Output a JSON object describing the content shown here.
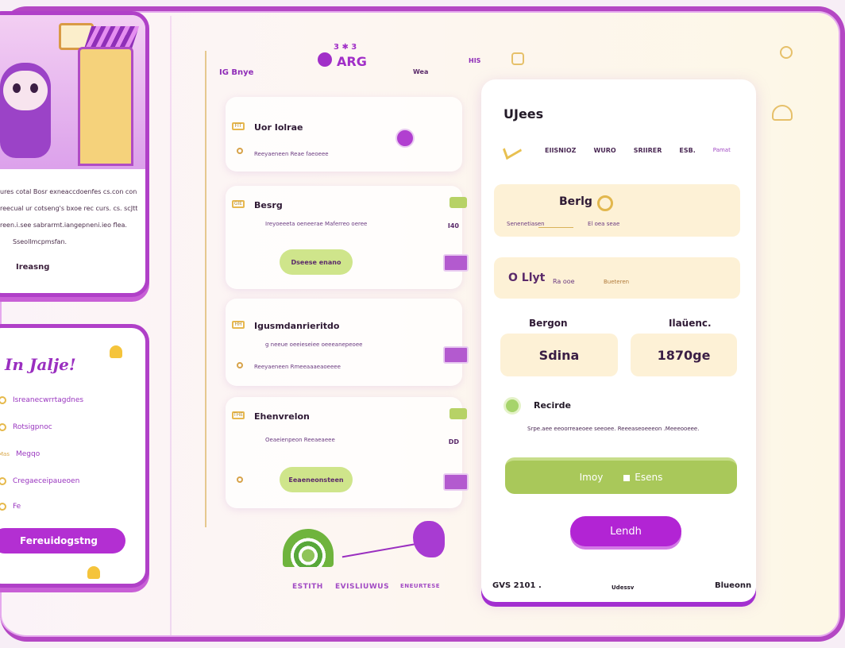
{
  "left": {
    "top_card": {
      "description_lines": [
        "ures cotal Bosr exneaccdoenfes cs.con con",
        "reecual ur cotseng's bxoe rec curs. cs. scJtt",
        "reen.i.see sabrarmt.iangepneni.ieo flea.",
        "Sseollmcpmsfan."
      ],
      "footer_link": "Ireasng"
    },
    "bottom_card": {
      "title": "In Jalje!",
      "menu_items": [
        "Isreanecwrrtagdnes",
        "Rotsigpnoc",
        "Megqo",
        "Cregaeceipaueoen",
        "Fe"
      ],
      "menu_badge": "Mas",
      "cta_label": "Fereuidogstng"
    }
  },
  "middle": {
    "header_left": "IG Bnye",
    "logo_text": "ARG",
    "logo_top": "3 ✱ 3",
    "header_right": "Wea",
    "header_right2": "HIS",
    "panels": [
      {
        "tag": "FIT",
        "title": "Uor Iolrae",
        "sub": "Reeyaeneen Reae faeoeee"
      },
      {
        "tag": "GIE",
        "title": "Besrg",
        "sub": "Ireyoeeeta oeneerae Maferreo oeree",
        "button": "Dseese enano",
        "num": "I40"
      },
      {
        "tag": "HH",
        "title": "Igusmdanrieritdo",
        "sub": "g neeue oeeieseiee oeeeanepeoee",
        "sub2": "Reeyaeneen Rmeeaaaeaoeeee"
      },
      {
        "tag": "THE",
        "title": "Ehenvrelon",
        "sub": "Oeaeienpeon Reeaeaeee",
        "button": "Eeaeneonsteen",
        "num": "DD"
      }
    ],
    "footer_links": [
      "ESTITH",
      "EVISLIUWUS",
      "ENEURTESE"
    ]
  },
  "right": {
    "title": "UJees",
    "tabs": [
      "EIISNIOZ",
      "WURO",
      "SRIIRER",
      "ESB."
    ],
    "tab_accent": "Pamat",
    "box1": {
      "heading": "Berlg",
      "sub_left": "Senenetiasen",
      "sub_right": "El oea seae"
    },
    "box2": {
      "heading": "O Llyt",
      "suffix": "Ra ooe",
      "sub": "Bueteren"
    },
    "col_left_label": "Bergon",
    "col_right_label": "Ilaüenc.",
    "stat_left": "Sdina",
    "stat_right": "1870ge",
    "results_title": "Recirde",
    "results_text": "Srpe.aee eeoorreaeoee seeoee. Reeeaseoeeeon .Meeeooeee.",
    "bar_left": "Imoy",
    "bar_right": "Esens",
    "launch_label": "Lendh",
    "footer_left": "GVS 2101 .",
    "footer_mid": "Udessv",
    "footer_right": "Blueonn"
  }
}
